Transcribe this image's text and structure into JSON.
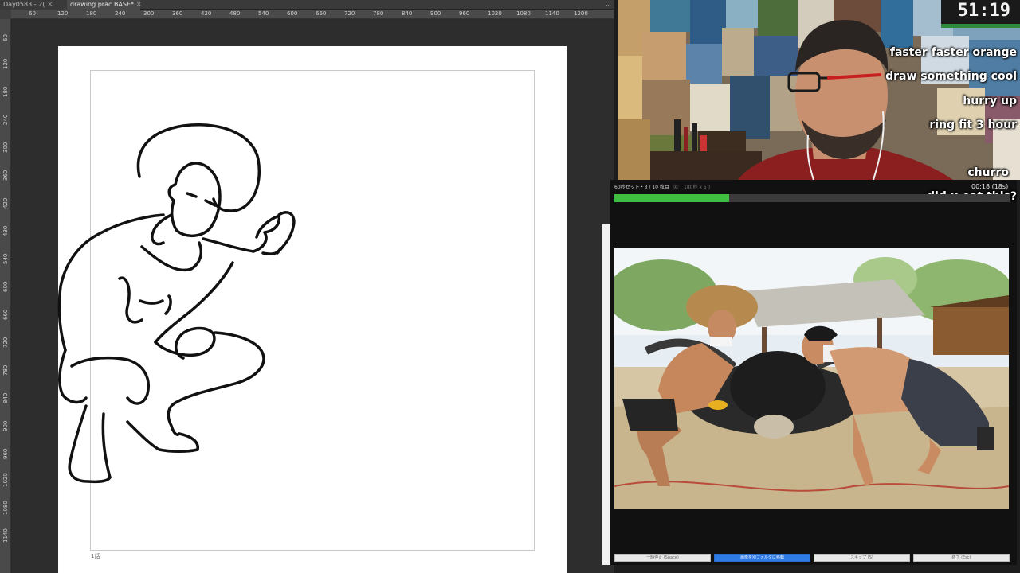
{
  "app": {
    "tabs": [
      {
        "label": "Day0583 - 2(",
        "active": false
      },
      {
        "label": "drawing prac BASE*",
        "active": true
      }
    ],
    "ruler_top_labels": [
      "60",
      "120",
      "180",
      "240",
      "300",
      "360",
      "420",
      "480",
      "540",
      "600",
      "660",
      "720",
      "780",
      "840",
      "900",
      "960",
      "1020",
      "1080",
      "1140",
      "1200"
    ],
    "ruler_left_labels": [
      "60",
      "120",
      "180",
      "240",
      "300",
      "360",
      "420",
      "480",
      "540",
      "600",
      "660",
      "720",
      "780",
      "840",
      "900",
      "960",
      "1020",
      "1080",
      "1140"
    ],
    "page_label": "1話"
  },
  "stream": {
    "timer": "51:19",
    "chat": [
      "faster faster orange",
      "draw something cool",
      "hurry up",
      "ring fit 3 hour",
      "churro",
      "did u eat this?"
    ]
  },
  "reference_panel": {
    "header": "60秒セット・3 / 10 枚目",
    "header_dim": "次: [ 180秒 x 5 ]",
    "time": "00:18 (18s)",
    "progress": 0.29,
    "buttons": [
      "一時停止 (Space)",
      "画像を別フォルダに移動",
      "スキップ (S)",
      "終了 (Esc)"
    ]
  },
  "colors": {
    "accent_green": "#3fbf3f",
    "primary_button": "#2f7be6"
  }
}
